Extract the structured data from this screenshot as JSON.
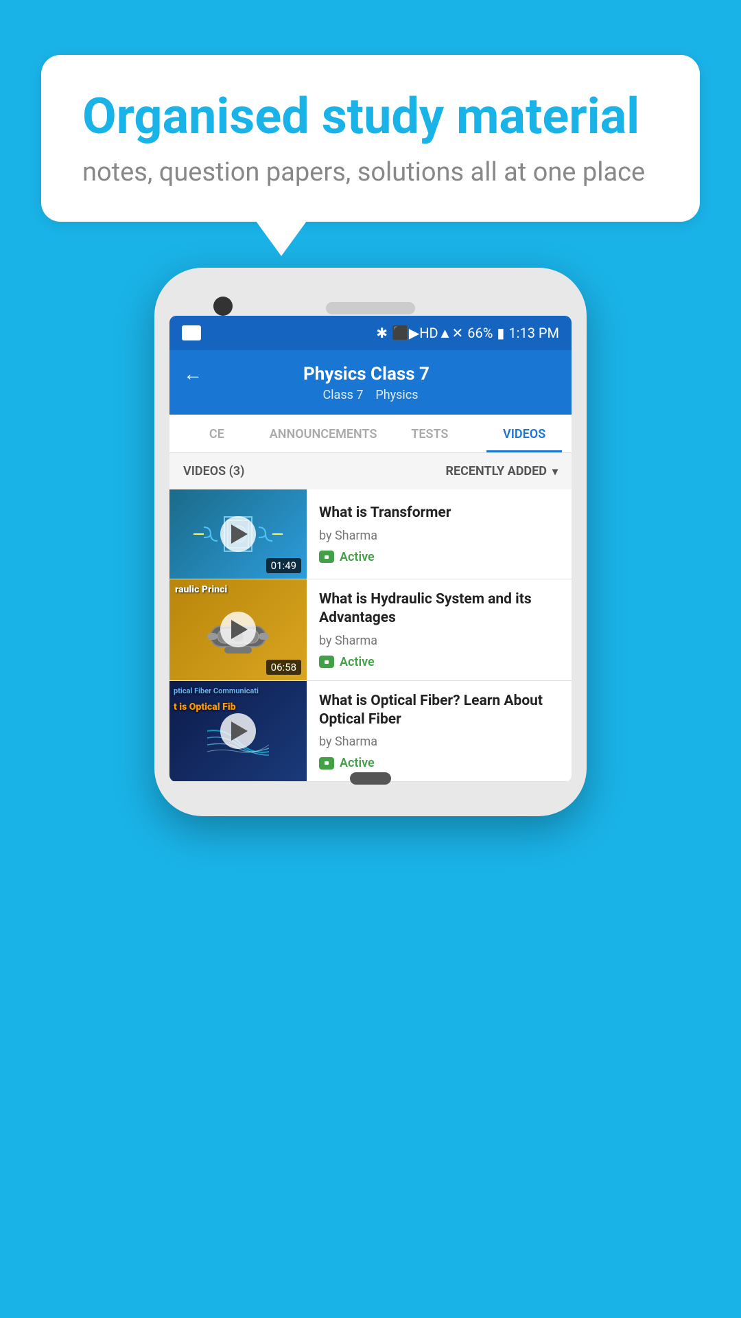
{
  "background_color": "#1ab3e8",
  "speech_bubble": {
    "title": "Organised study material",
    "subtitle": "notes, question papers, solutions all at one place"
  },
  "status_bar": {
    "time": "1:13 PM",
    "battery": "66%",
    "signal_icons": "🔵📶📶"
  },
  "app_header": {
    "title": "Physics Class 7",
    "subtitle_class": "Class 7",
    "subtitle_subject": "Physics",
    "back_label": "←"
  },
  "tabs": [
    {
      "id": "ce",
      "label": "CE",
      "active": false
    },
    {
      "id": "announcements",
      "label": "ANNOUNCEMENTS",
      "active": false
    },
    {
      "id": "tests",
      "label": "TESTS",
      "active": false
    },
    {
      "id": "videos",
      "label": "VIDEOS",
      "active": true
    }
  ],
  "filter_bar": {
    "count_label": "VIDEOS (3)",
    "sort_label": "RECENTLY ADDED"
  },
  "videos": [
    {
      "title": "What is  Transformer",
      "author": "by Sharma",
      "status": "Active",
      "duration": "01:49",
      "thumbnail_type": "transformer"
    },
    {
      "title": "What is Hydraulic System and its Advantages",
      "author": "by Sharma",
      "status": "Active",
      "duration": "06:58",
      "thumbnail_type": "hydraulic",
      "thumbnail_text1": "raulic Princi",
      "thumbnail_text2": ""
    },
    {
      "title": "What is Optical Fiber? Learn About Optical Fiber",
      "author": "by Sharma",
      "status": "Active",
      "duration": "",
      "thumbnail_type": "optical",
      "thumbnail_text1": "ptical Fiber Communicati",
      "thumbnail_text2": "t is Optical Fib"
    }
  ],
  "icons": {
    "play": "▶",
    "chevron_down": "▾",
    "back_arrow": "←",
    "chat": "💬"
  }
}
